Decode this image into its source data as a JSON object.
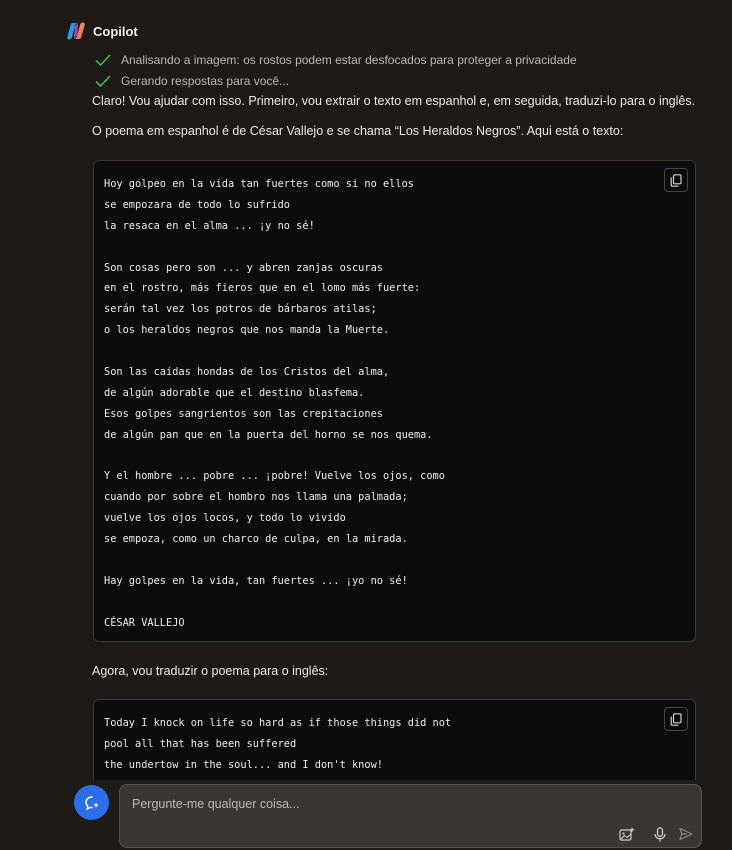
{
  "header": {
    "brand": "Copilot"
  },
  "status": [
    {
      "text": "Analisando a imagem: os rostos podem estar desfocados para proteger a privacidade"
    },
    {
      "text": "Gerando respostas para você..."
    }
  ],
  "messages": {
    "intro": "Claro! Vou ajudar com isso. Primeiro, vou extrair o texto em espanhol e, em seguida, traduzi-lo para o inglês.",
    "poem_intro": "O poema em espanhol é de César Vallejo e se chama “Los Heraldos Negros”. Aqui está o texto:",
    "translate_intro": "Agora, vou traduzir o poema para o inglês:"
  },
  "spanish_code": {
    "lines": [
      "Hoy golpeo en la vida tan fuertes como si no ellos",
      "se empozara de todo lo sufrido",
      "la resaca en el alma ... ¡y no sé!",
      "",
      "Son cosas pero son ... y abren zanjas oscuras",
      "en el rostro, más fieros que en el lomo más fuerte:",
      "serán tal vez los potros de bárbaros atilas;",
      "o los heraldos negros que nos manda la Muerte.",
      "",
      "Son las caídas hondas de los Cristos del alma,",
      "de algún adorable que el destino blasfema.",
      "Esos golpes sangrientos son las crepitaciones",
      "de algún pan que en la puerta del horno se nos quema.",
      "",
      "Y el hombre ... pobre ... ¡pobre! Vuelve los ojos, como",
      "cuando por sobre el hombro nos llama una palmada;",
      "vuelve los ojos locos, y todo lo vivido",
      "se empoza, como un charco de culpa, en la mirada.",
      "",
      "Hay golpes en la vida, tan fuertes ... ¡yo no sé!",
      "",
      "CÉSAR VALLEJO"
    ]
  },
  "english_code": {
    "lines": [
      "Today I knock on life so hard as if those things did not",
      "pool all that has been suffered",
      "the undertow in the soul... and I don't know!"
    ]
  },
  "composer": {
    "placeholder": "Pergunte-me qualquer coisa..."
  },
  "colors": {
    "accent": "#2a6ee8",
    "check": "#3fb950",
    "background": "#1d1a18",
    "code_bg": "#0d0c0c"
  }
}
